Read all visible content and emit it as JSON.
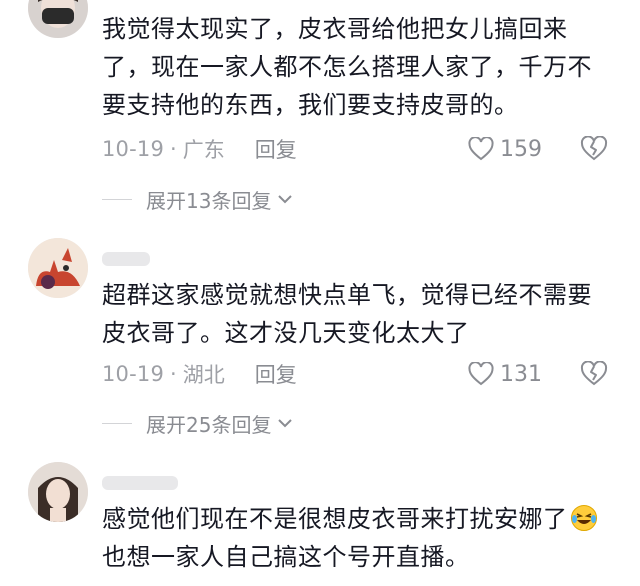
{
  "comments": [
    {
      "text_lines": [
        "我觉得太现实了，皮衣哥给他把女儿搞回来",
        "了，现在一家人都不怎么搭理人家了，千万不",
        "要支持他的东西，我们要支持皮哥的。"
      ],
      "date": "10-19",
      "location": "广东",
      "reply_label": "回复",
      "likes": "159",
      "expand_label": "展开13条回复"
    },
    {
      "text_lines": [
        "超群这家感觉就想快点单飞，觉得已经不需要",
        "皮衣哥了。这才没几天变化太大了"
      ],
      "date": "10-19",
      "location": "湖北",
      "reply_label": "回复",
      "likes": "131",
      "expand_label": "展开25条回复"
    },
    {
      "text_lines": [
        "感觉他们现在不是很想皮衣哥来打扰安娜了",
        "也想一家人自己搞这个号开直播。"
      ],
      "emoji": "laughing-crying-emoji"
    }
  ],
  "meta_separator": "·",
  "colors": {
    "text": "#161823",
    "meta": "#9ea0a6",
    "icon": "#8a8c92"
  }
}
